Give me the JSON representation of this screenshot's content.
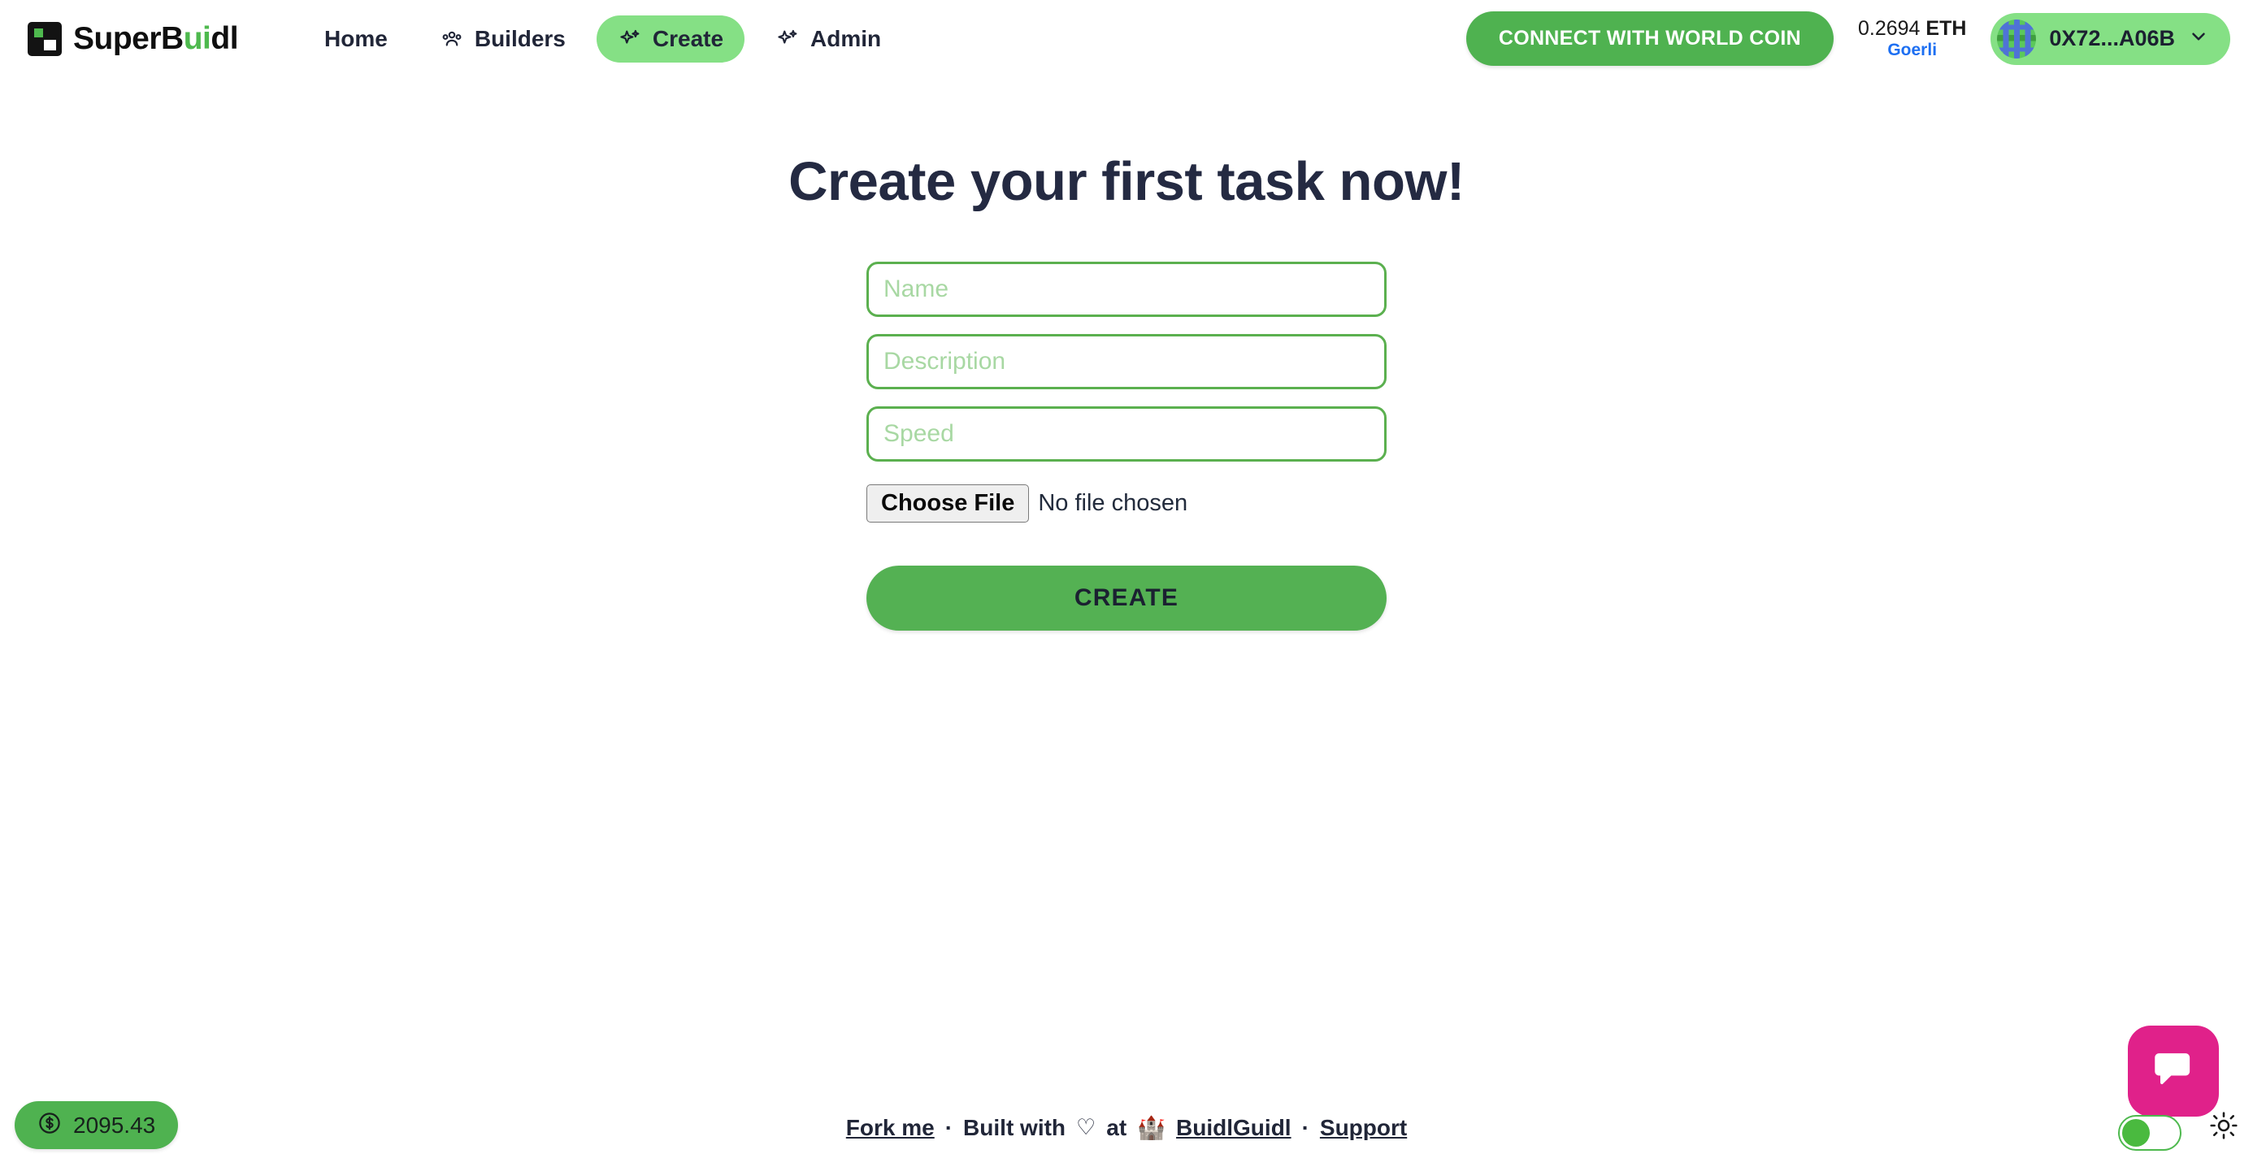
{
  "header": {
    "brand": {
      "text_dark_1": "SuperB",
      "text_green": "ui",
      "text_dark_2": "dl",
      "icon": "pixel-logo-icon"
    },
    "nav": [
      {
        "label": "Home",
        "icon": "none",
        "active": false
      },
      {
        "label": "Builders",
        "icon": "users-icon",
        "active": false
      },
      {
        "label": "Create",
        "icon": "sparkles-icon",
        "active": true
      },
      {
        "label": "Admin",
        "icon": "sparkles-icon",
        "active": false
      }
    ],
    "connect_button": {
      "label": "CONNECT WITH WORLD COIN",
      "color": "#4fb250"
    },
    "wallet": {
      "balance_amount": "0.2694",
      "balance_unit": "ETH",
      "network": "Goerli",
      "network_color": "#1d6ff2",
      "address": "0X72...A06B",
      "pill_color": "#85e085",
      "avatar": "blockie-avatar",
      "chevron": "chevron-down-icon"
    }
  },
  "main": {
    "title": "Create your first task now!",
    "fields": [
      {
        "name": "name",
        "placeholder": "Name",
        "value": ""
      },
      {
        "name": "description",
        "placeholder": "Description",
        "value": ""
      },
      {
        "name": "speed",
        "placeholder": "Speed",
        "value": ""
      }
    ],
    "file_input": {
      "button_label": "Choose File",
      "status": "No file chosen"
    },
    "submit_button": {
      "label": "CREATE",
      "color": "#54b153"
    }
  },
  "footer": {
    "fork_me": "Fork me",
    "separator_1": "·",
    "built_with": "Built with",
    "heart": "♡",
    "at": "at",
    "castle": "🏰",
    "buidlguidl": "BuidlGuidl",
    "separator_2": "·",
    "support": "Support"
  },
  "widgets": {
    "faucet": {
      "icon": "dollar-circle-icon",
      "amount": "2095.43",
      "color": "#4fb250"
    },
    "chat": {
      "icon": "chat-bubble-icon",
      "color": "#e0218a"
    },
    "theme_toggle": {
      "state": "on",
      "accent": "#4aba3f"
    },
    "sun": {
      "icon": "sun-icon"
    }
  }
}
